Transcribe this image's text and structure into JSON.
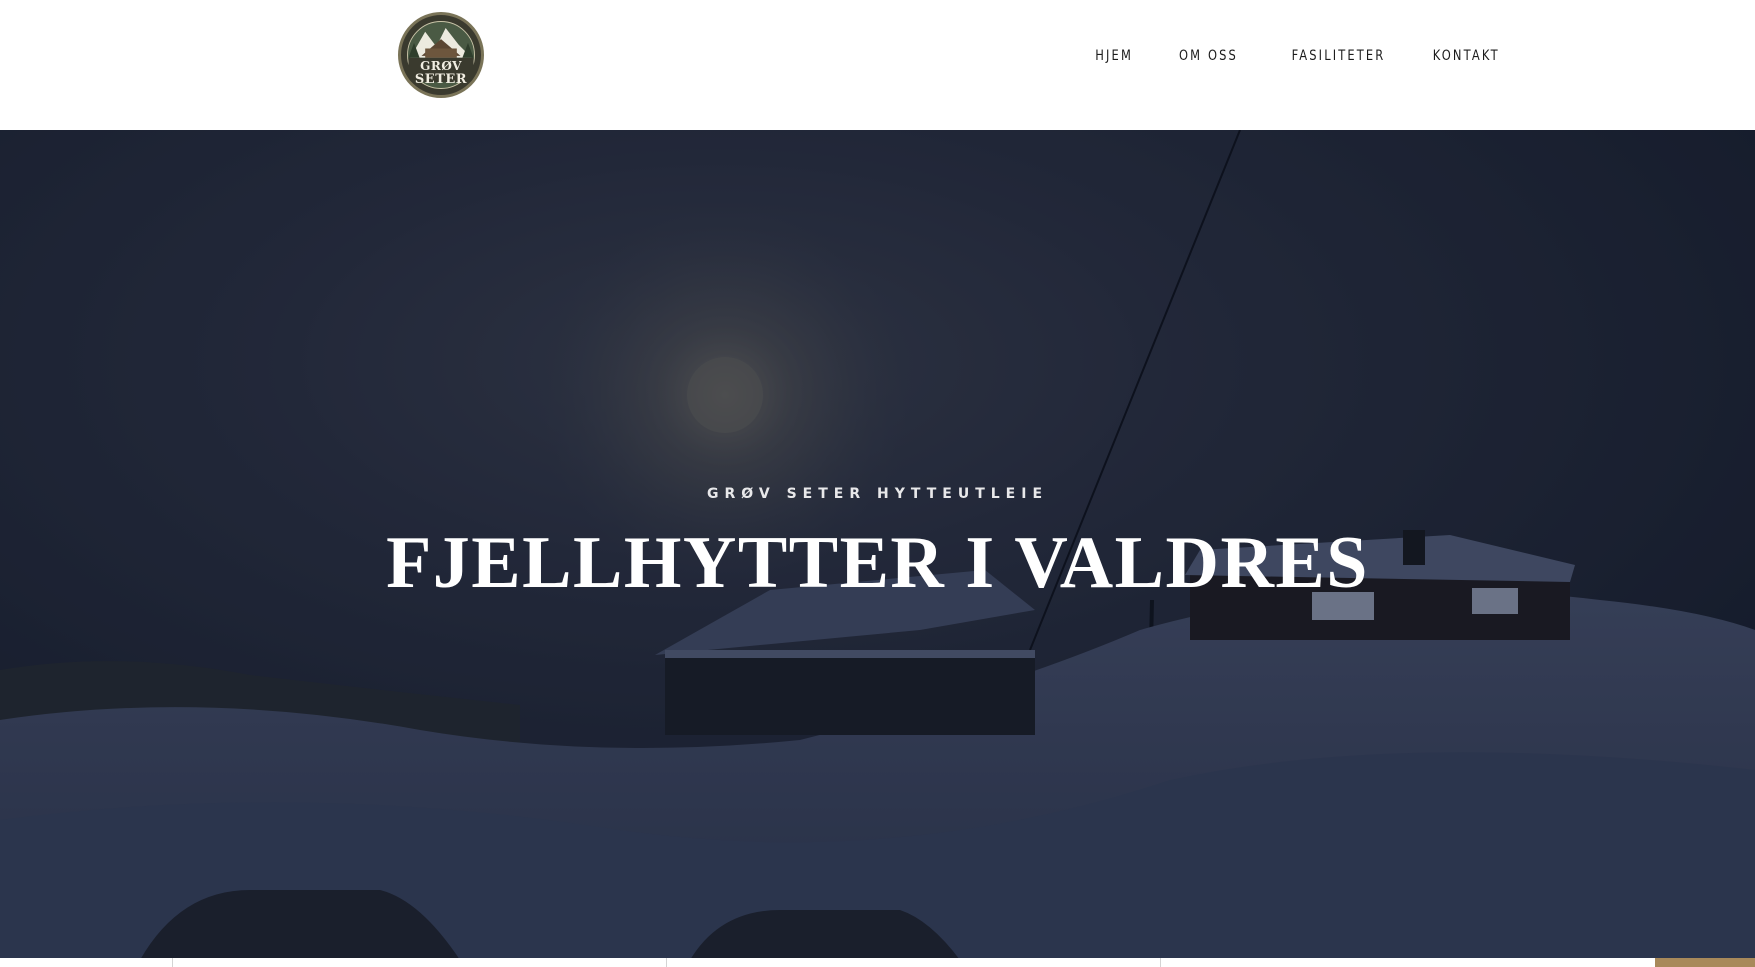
{
  "logo": {
    "line1": "GRØV",
    "line2": "SETER",
    "icon": "cabin-mountain-logo"
  },
  "nav": {
    "items": [
      {
        "label": "HJEM"
      },
      {
        "label": "OM OSS"
      },
      {
        "label": "FASILITETER"
      },
      {
        "label": "KONTAKT"
      }
    ]
  },
  "hero": {
    "eyebrow": "GRØV SETER HYTTEUTLEIE",
    "title": "FJELLHYTTER I VALDRES"
  },
  "colors": {
    "accent": "#a8895a",
    "hero_overlay": "#1b2336",
    "nav_text": "#1c1c1c"
  }
}
